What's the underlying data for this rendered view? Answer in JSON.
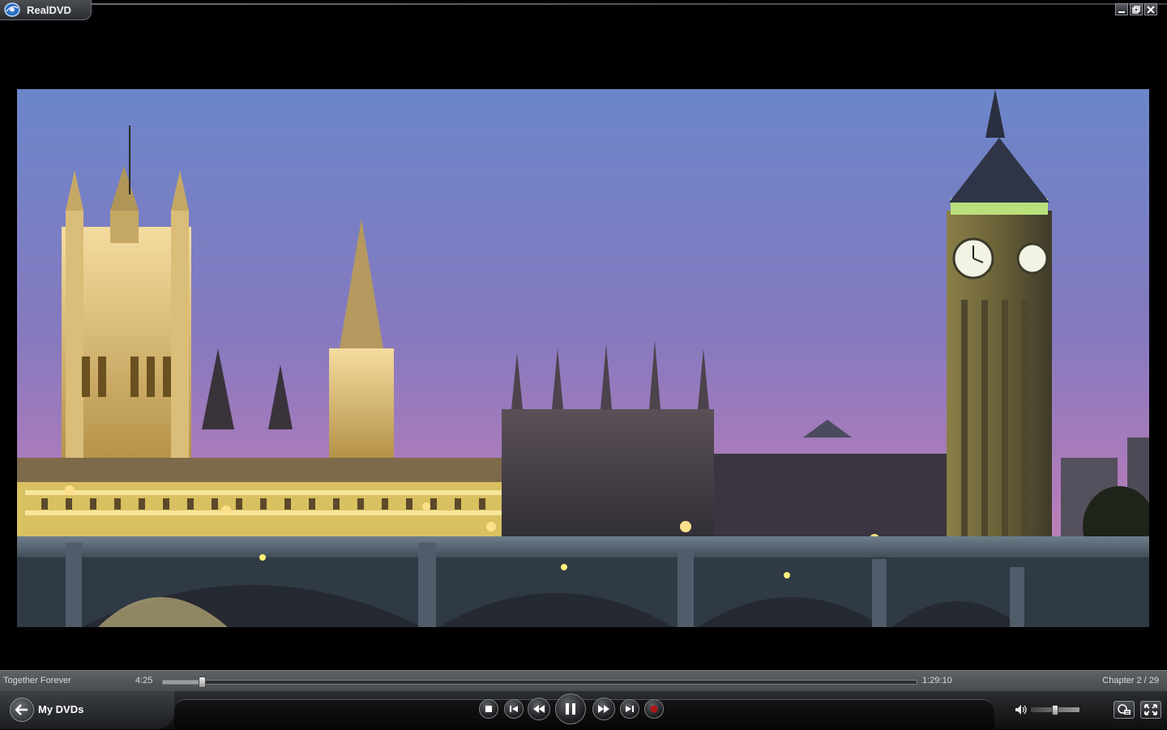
{
  "window": {
    "title": "RealDVD"
  },
  "playback": {
    "track_title": "Together Forever",
    "elapsed": "4:25",
    "duration": "1:29:10",
    "chapter": "Chapter 2 / 29",
    "progress_fraction": 0.05
  },
  "nav": {
    "back_label": "My DVDs"
  },
  "volume": {
    "level_fraction": 0.48
  },
  "colors": {
    "accent": "#4a8fd8",
    "record": "#b01818"
  },
  "icons": {
    "window": [
      "minimize-icon",
      "restore-icon",
      "close-icon"
    ],
    "transport": [
      "stop-icon",
      "previous-icon",
      "rewind-icon",
      "pause-icon",
      "fast-forward-icon",
      "next-icon",
      "record-icon"
    ],
    "right": [
      "volume-icon",
      "subtitles-icon",
      "fullscreen-icon"
    ]
  }
}
